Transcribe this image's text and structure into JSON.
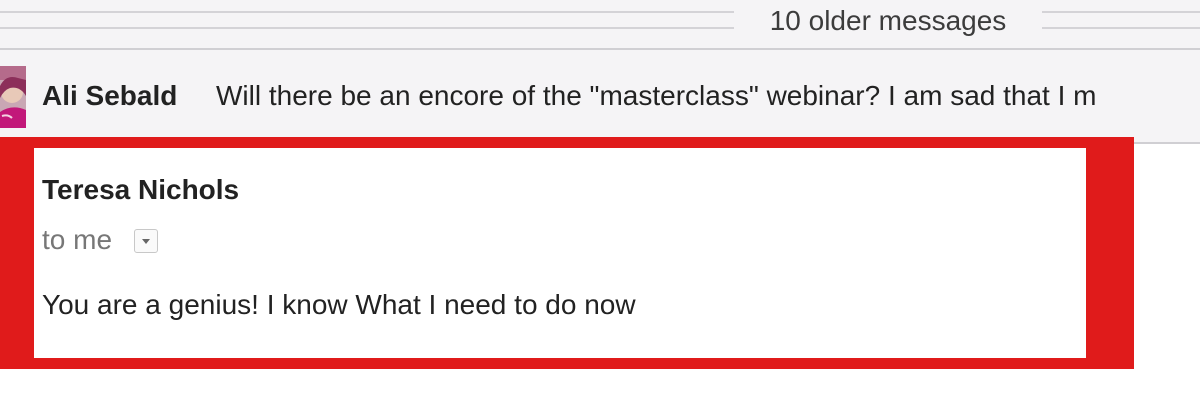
{
  "thread": {
    "older_messages_label": "10 older messages"
  },
  "collapsed_message": {
    "sender": "Ali Sebald",
    "snippet": "Will there be an encore of the \"masterclass\" webinar? I am sad that I m"
  },
  "open_message": {
    "sender": "Teresa Nichols",
    "recipient": "to me",
    "body_first_line": "You are a genius! I know What I need to do now"
  },
  "colors": {
    "highlight": "#e01b1b",
    "header_background": "#f5f4f6",
    "sender_text": "#222222",
    "recipient_text": "#777777"
  },
  "icons": {
    "avatar": "avatar",
    "details_toggle": "chevron-down-icon"
  }
}
